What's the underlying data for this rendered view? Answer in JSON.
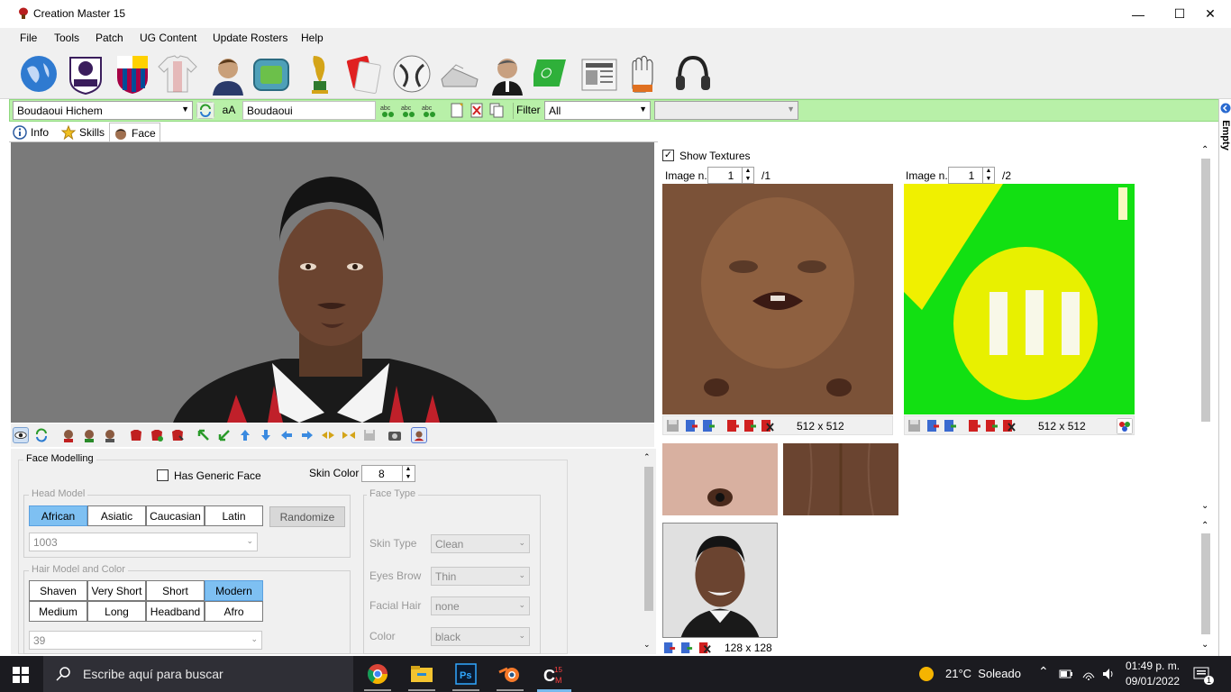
{
  "window": {
    "title": "Creation Master 15",
    "minimize": "—",
    "maximize": "☐",
    "close": "✕"
  },
  "menu": [
    "File",
    "Tools",
    "Patch",
    "UG Content",
    "Update Rosters",
    "Help"
  ],
  "toolbar_icons": [
    "globe-icon",
    "premier-league-icon",
    "barcelona-crest-icon",
    "jersey-icon",
    "player-icon",
    "stadium-icon",
    "world-cup-trophy-icon",
    "cards-icon",
    "ball-icon",
    "boots-icon",
    "manager-icon",
    "pitch-icon",
    "newspaper-icon",
    "gloves-icon",
    "headphones-icon"
  ],
  "selector": {
    "player": "Boudaoui Hichem",
    "search_value": "Boudaoui",
    "filter_label": "Filter",
    "filter_value": "All",
    "extra_combo": "",
    "case_label": "aA"
  },
  "tabs": [
    {
      "label": "Info",
      "icon": "info-icon"
    },
    {
      "label": "Skills",
      "icon": "star-icon"
    },
    {
      "label": "Face",
      "icon": "face-icon"
    }
  ],
  "face_modelling": {
    "title": "Face Modelling",
    "has_generic_face": "Has Generic Face",
    "skin_color_label": "Skin Color",
    "skin_color_value": "8",
    "head_model_title": "Head Model",
    "head_models": [
      "African",
      "Asiatic",
      "Caucasian",
      "Latin"
    ],
    "head_selected": "African",
    "randomize": "Randomize",
    "head_id": "1003",
    "hair_title": "Hair Model and Color",
    "hair_models": [
      "Shaven",
      "Very Short",
      "Short",
      "Modern",
      "Medium",
      "Long",
      "Headband",
      "Afro"
    ],
    "hair_selected": "Modern",
    "hair_id": "39",
    "face_type_title": "Face Type",
    "skin_type_label": "Skin Type",
    "skin_type_value": "Clean",
    "eyes_brow_label": "Eyes Brow",
    "eyes_brow_value": "Thin",
    "facial_hair_label": "Facial Hair",
    "facial_hair_value": "none",
    "color_label": "Color",
    "color_value": "black"
  },
  "textures": {
    "show_textures": "Show Textures",
    "image_label": "Image n.",
    "left_image_value": "1",
    "left_image_total": "/1",
    "right_image_value": "1",
    "right_image_total": "/2",
    "left_size": "512 x 512",
    "right_size": "512 x 512",
    "photo_size": "128 x 128"
  },
  "side_panel": {
    "label": "Empty"
  },
  "taskbar": {
    "search_placeholder": "Escribe aquí para buscar",
    "weather": "21°C  Soleado",
    "time": "01:49 p. m.",
    "date": "09/01/2022"
  },
  "colors": {
    "selector_bar": "#b8f0a8",
    "selected_button": "#7ec0f2",
    "viewport_bg": "#7a7a7a"
  }
}
